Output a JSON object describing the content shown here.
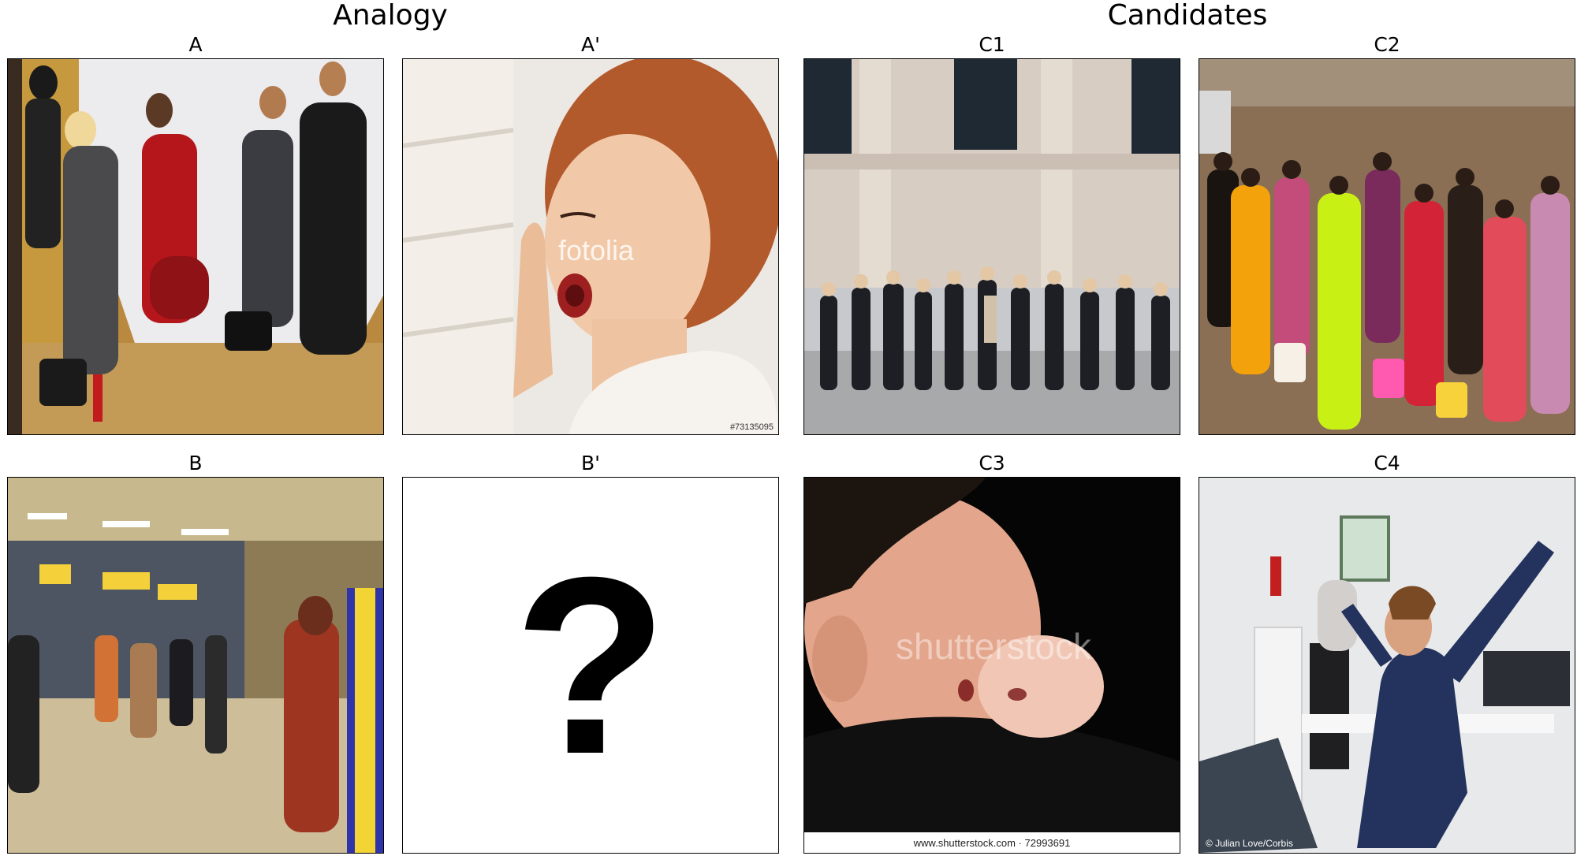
{
  "sections": {
    "analogy": "Analogy",
    "candidates": "Candidates"
  },
  "panels": {
    "A": {
      "label": "A"
    },
    "A2": {
      "label": "A'",
      "watermark": "fotolia",
      "caption": "#73135095"
    },
    "B": {
      "label": "B"
    },
    "B2": {
      "label": "B'",
      "symbol": "?"
    },
    "C1": {
      "label": "C1"
    },
    "C2": {
      "label": "C2"
    },
    "C3": {
      "label": "C3",
      "watermark": "shutterstock",
      "caption": "www.shutterstock.com · 72993691"
    },
    "C4": {
      "label": "C4",
      "caption": "© Julian Love/Corbis"
    }
  }
}
